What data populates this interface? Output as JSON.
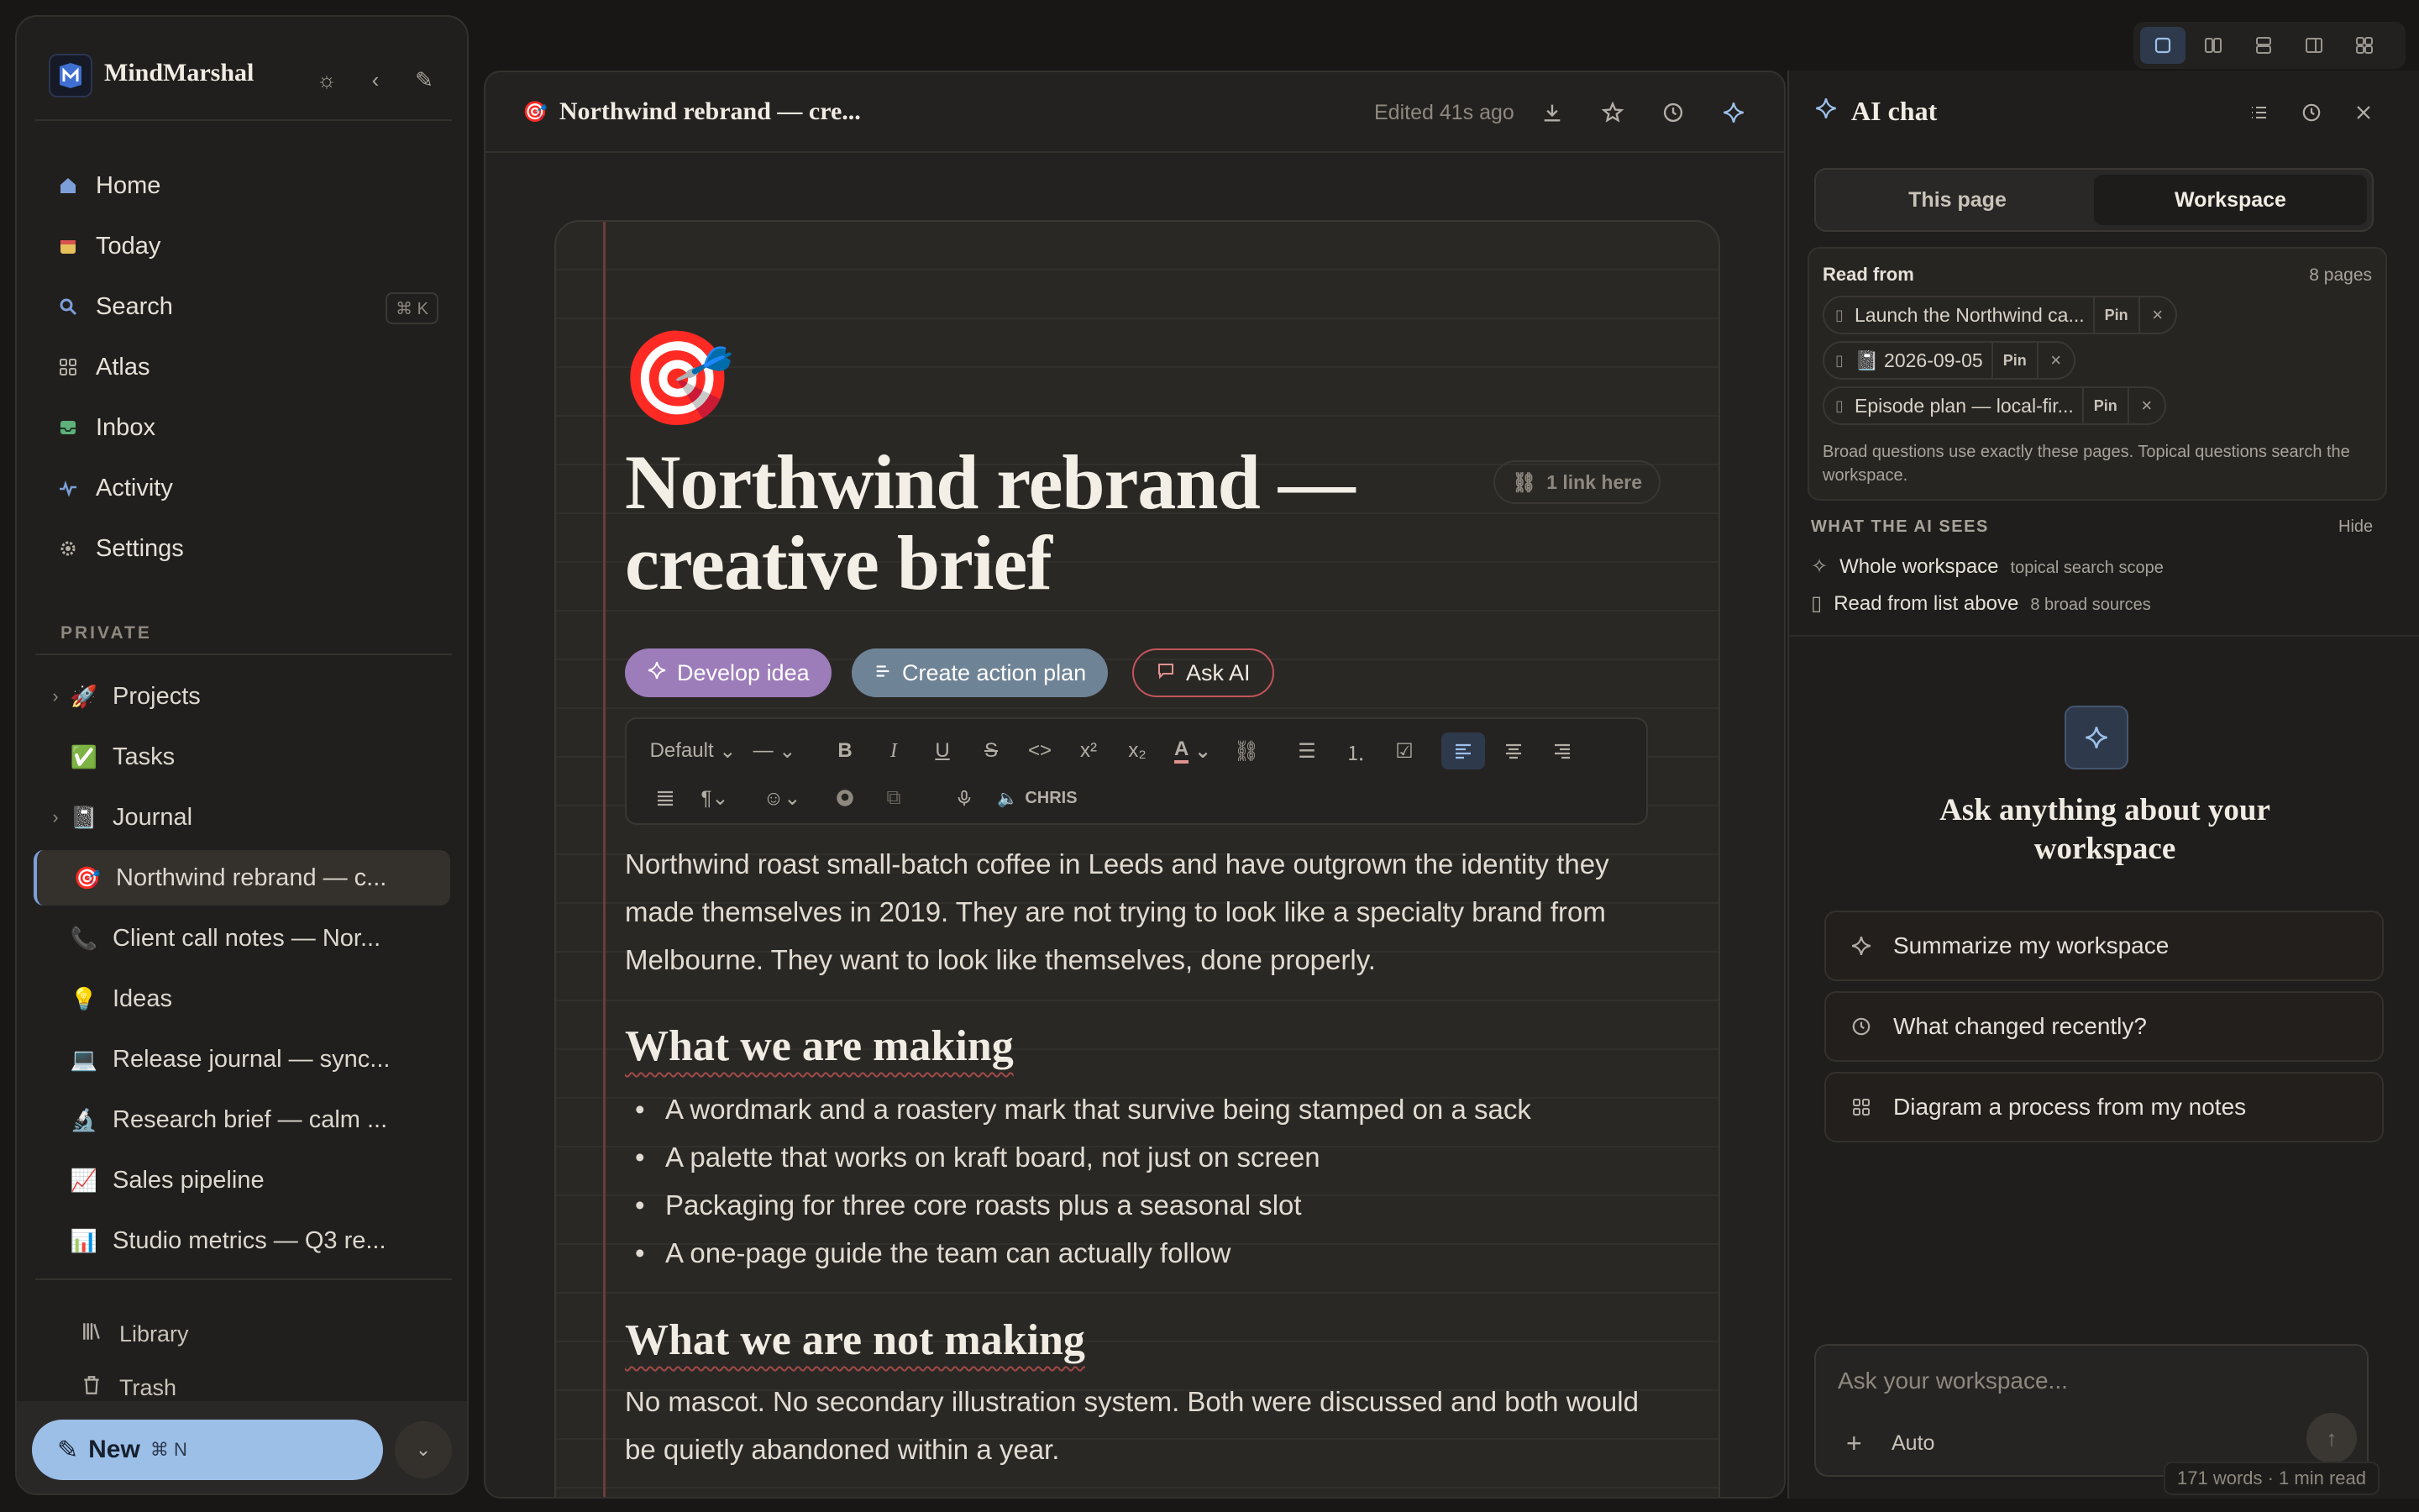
{
  "app": {
    "name": "MindMarshal"
  },
  "sidebar": {
    "nav": [
      {
        "label": "Home",
        "icon": "home-icon"
      },
      {
        "label": "Today",
        "icon": "calendar-icon"
      },
      {
        "label": "Search",
        "icon": "search-icon",
        "shortcut": "⌘ K"
      },
      {
        "label": "Atlas",
        "icon": "grid-icon"
      },
      {
        "label": "Inbox",
        "icon": "inbox-icon"
      },
      {
        "label": "Activity",
        "icon": "activity-icon"
      },
      {
        "label": "Settings",
        "icon": "gear-icon"
      }
    ],
    "section_label": "PRIVATE",
    "tree": [
      {
        "label": "Projects",
        "emoji": "🚀",
        "expandable": true
      },
      {
        "label": "Tasks",
        "emoji": "✅",
        "expandable": false
      },
      {
        "label": "Journal",
        "emoji": "📓",
        "expandable": true
      },
      {
        "label": "Northwind rebrand — c...",
        "emoji": "🎯",
        "active": true
      },
      {
        "label": "Client call notes — Nor...",
        "emoji": "📞"
      },
      {
        "label": "Ideas",
        "emoji": "💡"
      },
      {
        "label": "Release journal — sync...",
        "emoji": "💻"
      },
      {
        "label": "Research brief — calm ...",
        "emoji": "🔬"
      },
      {
        "label": "Sales pipeline",
        "emoji": "📈"
      },
      {
        "label": "Studio metrics — Q3 re...",
        "emoji": "📊"
      }
    ],
    "footer": [
      {
        "label": "Library",
        "icon": "library-icon"
      },
      {
        "label": "Trash",
        "icon": "trash-icon"
      }
    ],
    "new_button": {
      "label": "New",
      "shortcut": "⌘ N"
    }
  },
  "document": {
    "header_title": "Northwind rebrand — cre...",
    "header_emoji": "🎯",
    "edited": "Edited 41s ago",
    "emoji": "🎯",
    "title": "Northwind rebrand — creative brief",
    "backlinks": "1 link here",
    "actions": {
      "develop": "Develop idea",
      "plan": "Create action plan",
      "ask": "Ask AI"
    },
    "toolbar": {
      "style_select": "Default",
      "divider_select": "—",
      "voice_label": "CHRIS"
    },
    "intro": "Northwind roast small-batch coffee in Leeds and have outgrown the identity they made themselves in 2019. They are not trying to look like a specialty brand from Melbourne. They want to look like themselves, done properly.",
    "section1": {
      "heading": "What we are making",
      "bullets": [
        "A wordmark and a roastery mark that survive being stamped on a sack",
        "A palette that works on kraft board, not just on screen",
        "Packaging for three core roasts plus a seasonal slot",
        "A one-page guide the team can actually follow"
      ]
    },
    "section2": {
      "heading": "What we are not making",
      "body": "No mascot. No secondary illustration system. Both were discussed and both would be quietly abandoned within a year."
    }
  },
  "ai_chat": {
    "title": "AI chat",
    "tabs": [
      "This page",
      "Workspace"
    ],
    "active_tab": "Workspace",
    "read_from": {
      "label": "Read from",
      "count": "8 pages",
      "pin_label": "Pin",
      "chips": [
        "Launch the Northwind ca...",
        "📓 2026-09-05",
        "Episode plan — local-fir..."
      ],
      "note": "Broad questions use exactly these pages. Topical questions search the workspace."
    },
    "sees": {
      "label": "WHAT THE AI SEES",
      "hide": "Hide",
      "rows": [
        {
          "main": "Whole workspace",
          "sub": "topical search scope"
        },
        {
          "main": "Read from list above",
          "sub": "8 broad sources"
        }
      ]
    },
    "hero": "Ask anything about your workspace",
    "suggestions": [
      {
        "label": "Summarize my workspace",
        "icon": "sparkle-icon"
      },
      {
        "label": "What changed recently?",
        "icon": "clock-icon"
      },
      {
        "label": "Diagram a process from my notes",
        "icon": "grid-icon"
      }
    ],
    "composer": {
      "placeholder": "Ask your workspace...",
      "mode": "Auto"
    }
  },
  "status": {
    "word_count": "171 words · 1 min read"
  },
  "colors": {
    "accent": "#9cbfe8",
    "background": "#181716",
    "purple_pill": "#9d7cba",
    "slate_pill": "#6f8396",
    "ask_border": "#c3545a"
  }
}
